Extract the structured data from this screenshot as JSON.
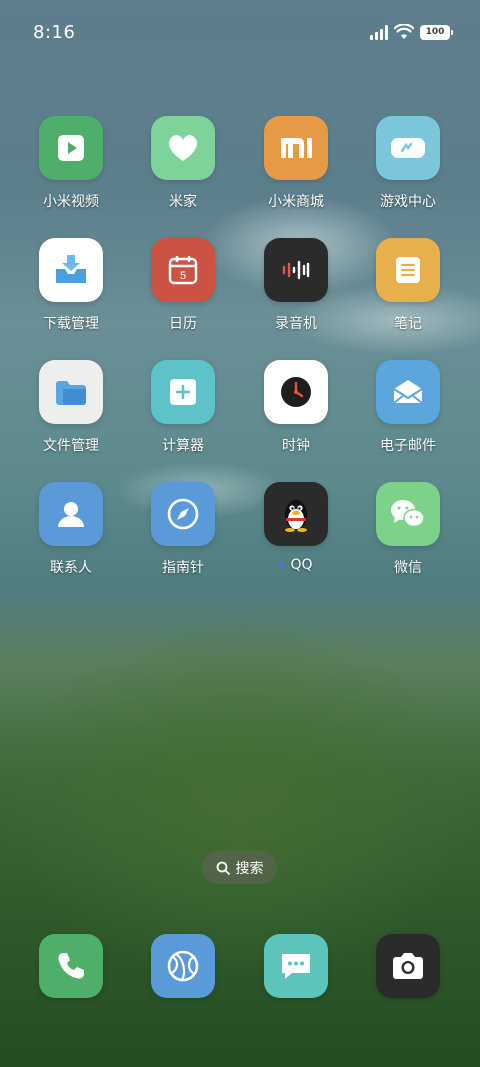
{
  "status_bar": {
    "time": "8:16",
    "battery": "100"
  },
  "apps": [
    {
      "label": "小米视频",
      "color": "#4fae6a",
      "icon": "play-icon"
    },
    {
      "label": "米家",
      "color": "#7ed39b",
      "icon": "heart-icon"
    },
    {
      "label": "小米商城",
      "color": "#e79a46",
      "icon": "mi-logo-icon"
    },
    {
      "label": "游戏中心",
      "color": "#7cc6dc",
      "icon": "vr-headset-icon"
    },
    {
      "label": "下载管理",
      "color": "#ffffff",
      "icon": "download-tray-icon"
    },
    {
      "label": "日历",
      "color": "#cc5244",
      "icon": "calendar-icon",
      "extra": "5"
    },
    {
      "label": "录音机",
      "color": "#2b2b2b",
      "icon": "waveform-icon"
    },
    {
      "label": "笔记",
      "color": "#e8b04c",
      "icon": "note-icon"
    },
    {
      "label": "文件管理",
      "color": "#eeeeee",
      "icon": "folder-icon"
    },
    {
      "label": "计算器",
      "color": "#5ec2c9",
      "icon": "plus-icon"
    },
    {
      "label": "时钟",
      "color": "#ffffff",
      "icon": "clock-icon"
    },
    {
      "label": "电子邮件",
      "color": "#5ba6dd",
      "icon": "envelope-icon"
    },
    {
      "label": "联系人",
      "color": "#5b9ad8",
      "icon": "person-icon"
    },
    {
      "label": "指南针",
      "color": "#5b9ad8",
      "icon": "compass-icon"
    },
    {
      "label": "QQ",
      "color": "#2b2b2b",
      "icon": "qq-penguin-icon"
    },
    {
      "label": "微信",
      "color": "#7dd28a",
      "icon": "wechat-icon"
    }
  ],
  "search": {
    "label": "搜索"
  },
  "dock": [
    {
      "name": "phone",
      "color": "#4fae6a",
      "icon": "phone-icon"
    },
    {
      "name": "browser",
      "color": "#5b9ad8",
      "icon": "globe-icon"
    },
    {
      "name": "messages",
      "color": "#5cc4ba",
      "icon": "message-icon"
    },
    {
      "name": "camera",
      "color": "#2b2b2b",
      "icon": "camera-icon"
    }
  ]
}
